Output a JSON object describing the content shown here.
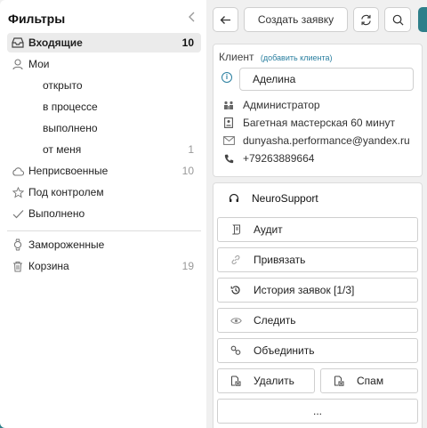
{
  "sidebar": {
    "title": "Фильтры",
    "collapse_icon": "chevron-left-icon",
    "items": [
      {
        "label": "Входящие",
        "count": "10",
        "icon": "inbox-icon"
      },
      {
        "label": "Мои",
        "count": "",
        "icon": "user-icon"
      },
      {
        "label": "открыто",
        "count": ""
      },
      {
        "label": "в процессе",
        "count": ""
      },
      {
        "label": "выполнено",
        "count": ""
      },
      {
        "label": "от меня",
        "count": "1"
      },
      {
        "label": "Неприсвоенные",
        "count": "10",
        "icon": "cloud-icon"
      },
      {
        "label": "Под контролем",
        "count": "",
        "icon": "star-icon"
      },
      {
        "label": "Выполнено",
        "count": "",
        "icon": "check-icon"
      },
      {
        "label": "Замороженные",
        "count": "",
        "icon": "watch-icon"
      },
      {
        "label": "Корзина",
        "count": "19",
        "icon": "trash-icon"
      }
    ]
  },
  "toolbar": {
    "back_icon": "arrow-left-icon",
    "create_label": "Создать заявку",
    "refresh_icon": "refresh-icon",
    "search_icon": "search-icon"
  },
  "client": {
    "title": "Клиент",
    "add_link": "(добавить клиента)",
    "name": "Аделина",
    "role": "Администратор",
    "company": "Багетная мастерская 60 минут",
    "email": "dunyasha.performance@yandex.ru",
    "phone": "+79263889664"
  },
  "actions": {
    "neurosupport": "NeuroSupport",
    "audit": "Аудит",
    "bind": "Привязать",
    "history": "История заявок [1/3]",
    "follow": "Следить",
    "merge": "Объединить",
    "delete": "Удалить",
    "spam": "Спам",
    "more": "..."
  },
  "colors": {
    "accent": "#2e7f8a",
    "link": "#2a7fa0"
  }
}
